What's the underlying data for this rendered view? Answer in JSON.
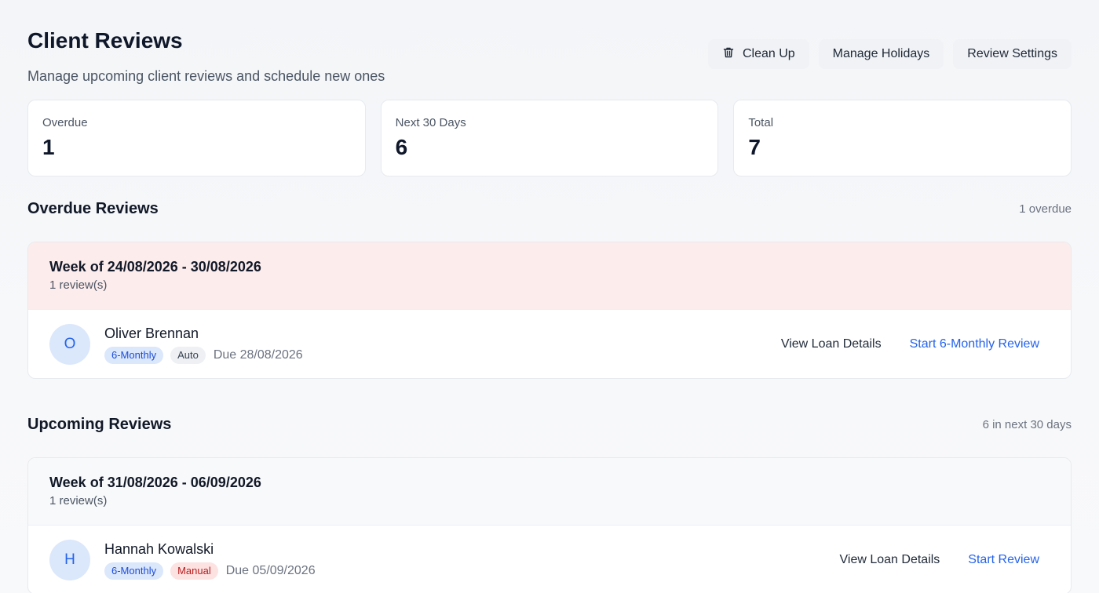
{
  "header": {
    "title": "Client Reviews",
    "subtitle": "Manage upcoming client reviews and schedule new ones",
    "actions": {
      "clean_up": "Clean Up",
      "manage_holidays": "Manage Holidays",
      "review_settings": "Review Settings"
    }
  },
  "stats": [
    {
      "label": "Overdue",
      "value": "1"
    },
    {
      "label": "Next 30 Days",
      "value": "6"
    },
    {
      "label": "Total",
      "value": "7"
    }
  ],
  "overdue": {
    "title": "Overdue Reviews",
    "count_text": "1 overdue",
    "groups": [
      {
        "week": "Week of 24/08/2026 - 30/08/2026",
        "count": "1 review(s)",
        "rows": [
          {
            "initial": "O",
            "name": "Oliver Brennan",
            "frequency": "6-Monthly",
            "source": "Auto",
            "due": "Due 28/08/2026",
            "view_label": "View Loan Details",
            "start_label": "Start 6-Monthly Review"
          }
        ]
      }
    ]
  },
  "upcoming": {
    "title": "Upcoming Reviews",
    "count_text": "6 in next 30 days",
    "groups": [
      {
        "week": "Week of 31/08/2026 - 06/09/2026",
        "count": "1 review(s)",
        "rows": [
          {
            "initial": "H",
            "name": "Hannah Kowalski",
            "frequency": "6-Monthly",
            "source": "Manual",
            "due": "Due 05/09/2026",
            "view_label": "View Loan Details",
            "start_label": "Start Review"
          }
        ]
      }
    ]
  },
  "colors": {
    "accent": "#2563eb",
    "overdue_bg": "#fdecec",
    "tag_blue_bg": "#dbe7fb",
    "tag_red_bg": "#fde2e2"
  }
}
